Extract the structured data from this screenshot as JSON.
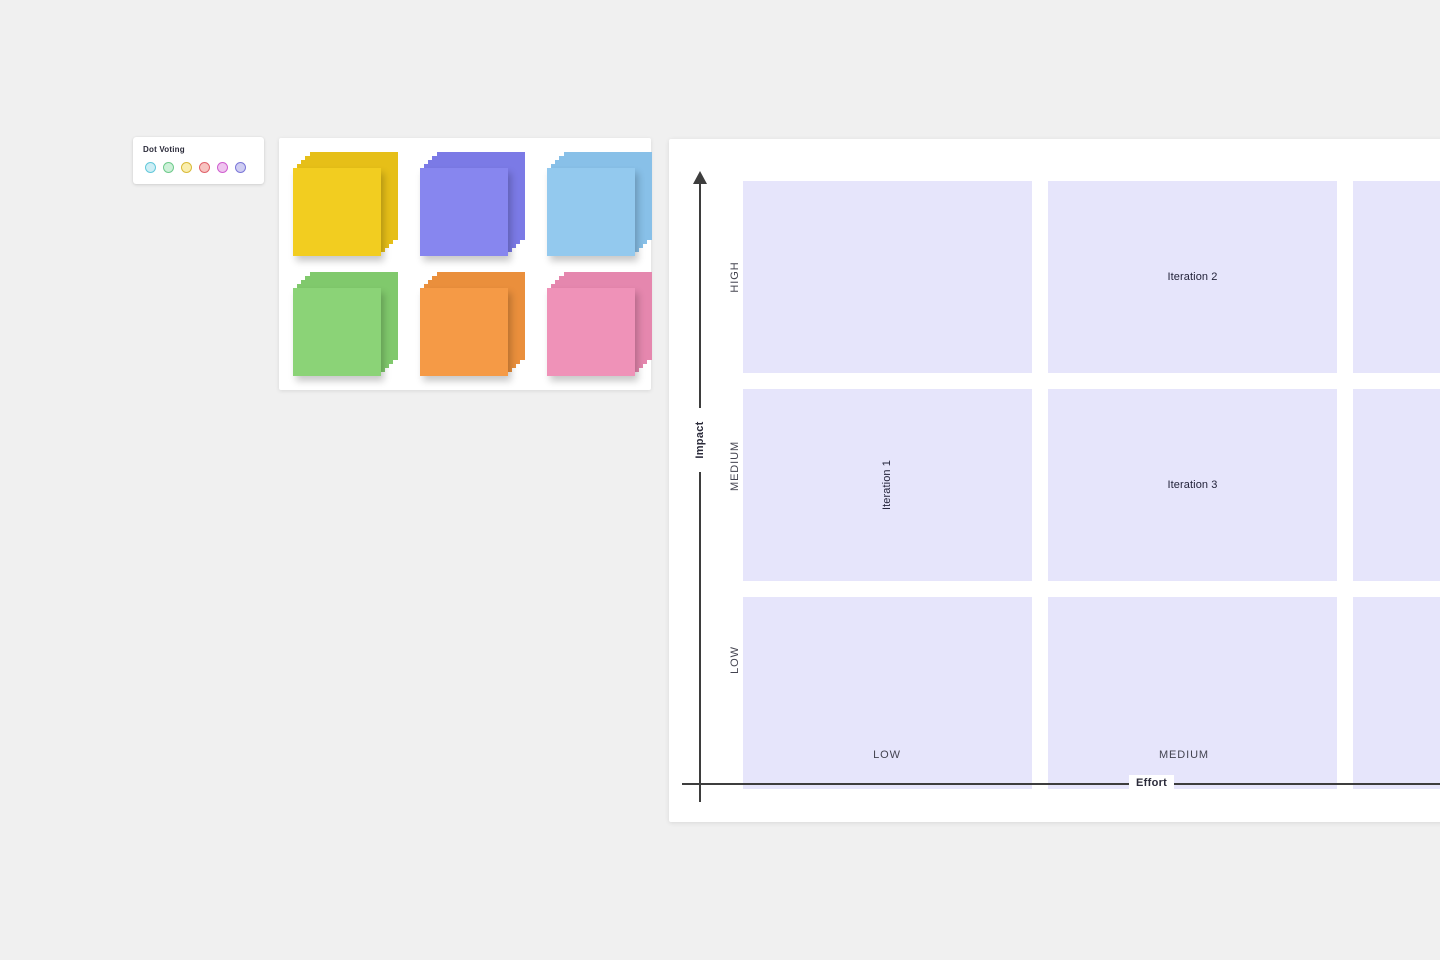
{
  "canvas": {
    "background_color": "#f0f0f0"
  },
  "dot_voting": {
    "title": "Dot Voting",
    "swatches": [
      {
        "name": "dot-swatch-cyan",
        "fill": "#cdeef5",
        "border": "#63c8da"
      },
      {
        "name": "dot-swatch-green",
        "fill": "#cdf0d8",
        "border": "#6fcb8c"
      },
      {
        "name": "dot-swatch-yellow",
        "fill": "#faeeae",
        "border": "#d9bb3a"
      },
      {
        "name": "dot-swatch-red",
        "fill": "#f7c3c0",
        "border": "#e0636b"
      },
      {
        "name": "dot-swatch-pink",
        "fill": "#efc4ef",
        "border": "#d05fd0"
      },
      {
        "name": "dot-swatch-purple",
        "fill": "#cfcdf2",
        "border": "#7b77d8"
      }
    ]
  },
  "sticky_notes": {
    "sheets_per_stack": 5,
    "stacks": [
      {
        "name": "sticky-stack-yellow",
        "color": "#f2cd20",
        "shade": "#e6bf18"
      },
      {
        "name": "sticky-stack-periwinkle",
        "color": "#8786ef",
        "shade": "#7b7ae6"
      },
      {
        "name": "sticky-stack-blue",
        "color": "#93c9ee",
        "shade": "#88c0e8"
      },
      {
        "name": "sticky-stack-green",
        "color": "#8bd377",
        "shade": "#80c96c"
      },
      {
        "name": "sticky-stack-orange",
        "color": "#f59a46",
        "shade": "#ea8f3c"
      },
      {
        "name": "sticky-stack-pink",
        "color": "#ef92b8",
        "shade": "#e587ae"
      }
    ]
  },
  "matrix": {
    "y_axis": {
      "title": "Impact",
      "ticks": [
        "HIGH",
        "MEDIUM",
        "LOW"
      ]
    },
    "x_axis": {
      "title": "Effort",
      "ticks": [
        "LOW",
        "MEDIUM"
      ]
    },
    "cell_color": "#e6e5fb",
    "cells": [
      {
        "name": "matrix-cell-high-low",
        "label": "",
        "orientation": "none"
      },
      {
        "name": "matrix-cell-high-medium",
        "label": "Iteration 2",
        "orientation": "horizontal"
      },
      {
        "name": "matrix-cell-high-high",
        "label": "",
        "orientation": "none"
      },
      {
        "name": "matrix-cell-medium-low",
        "label": "Iteration 1",
        "orientation": "vertical"
      },
      {
        "name": "matrix-cell-medium-medium",
        "label": "Iteration 3",
        "orientation": "horizontal"
      },
      {
        "name": "matrix-cell-medium-high",
        "label": "",
        "orientation": "none"
      },
      {
        "name": "matrix-cell-low-low",
        "label": "",
        "orientation": "none"
      },
      {
        "name": "matrix-cell-low-medium",
        "label": "",
        "orientation": "none"
      },
      {
        "name": "matrix-cell-low-high",
        "label": "",
        "orientation": "none"
      }
    ]
  }
}
